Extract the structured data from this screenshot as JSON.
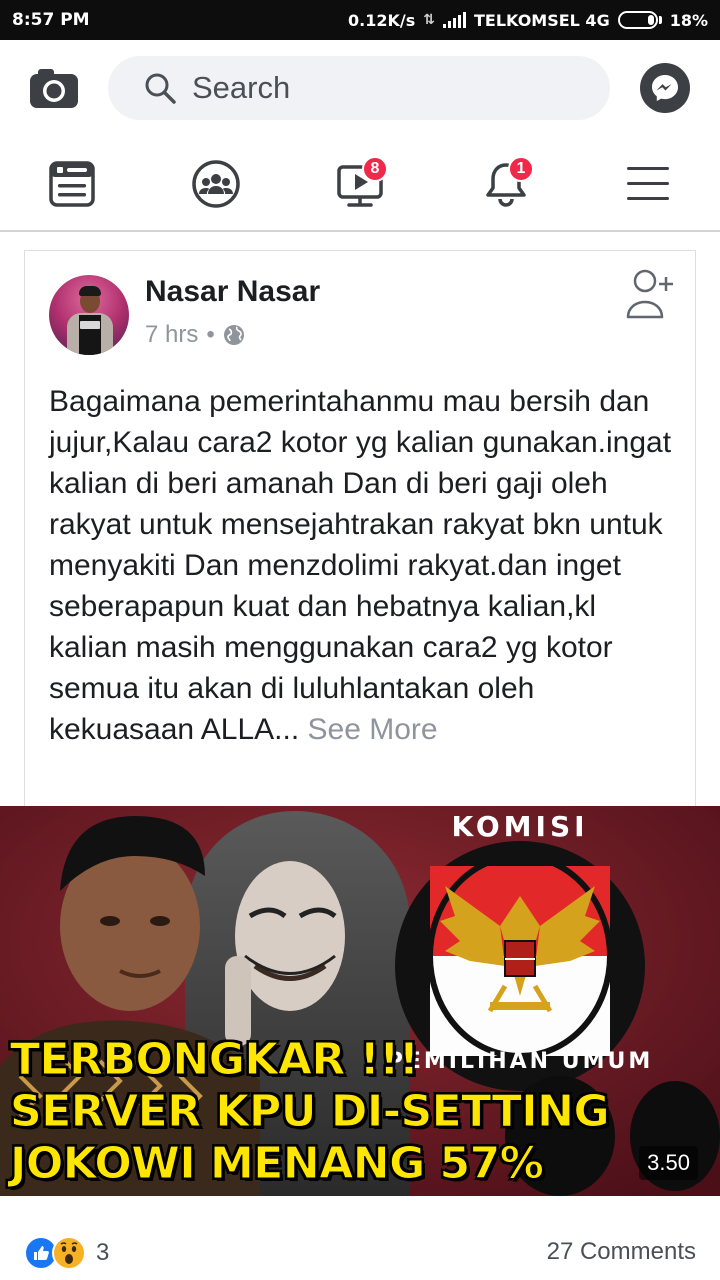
{
  "status_bar": {
    "time": "8:57 PM",
    "net_speed": "0.12K/s",
    "carrier": "TELKOMSEL 4G",
    "battery": "18%",
    "battery_level": 0.18
  },
  "header": {
    "search_placeholder": "Search"
  },
  "nav": {
    "watch_badge": "8",
    "notifications_badge": "1"
  },
  "post": {
    "author": "Nasar Nasar",
    "time": "7 hrs",
    "separator": "•",
    "text": "Bagaimana pemerintahanmu mau bersih dan jujur,Kalau cara2 kotor yg kalian gunakan.ingat kalian di beri amanah Dan di beri gaji oleh rakyat untuk mensejahtrakan rakyat bkn untuk menyakiti Dan menzdolimi rakyat.dan inget seberapapun kuat dan hebatnya kalian,kl kalian masih menggunakan cara2 yg kotor semua itu akan di luluhlantakan oleh kekuasaan ALLA...",
    "see_more": "See More",
    "image": {
      "emblem_top": "KOMISI",
      "emblem_bottom": "PEMILIHAN UMUM",
      "caption_line1": "TERBONGKAR !!!",
      "caption_line2": "SERVER KPU DI-SETTING",
      "caption_line3": "JOKOWI MENANG 57%",
      "duration": "3.50"
    },
    "reaction_count": "3",
    "comments": "27 Comments"
  },
  "colors": {
    "accent": "#1877f2",
    "badge": "#f02849",
    "wow": "#f7b125"
  }
}
